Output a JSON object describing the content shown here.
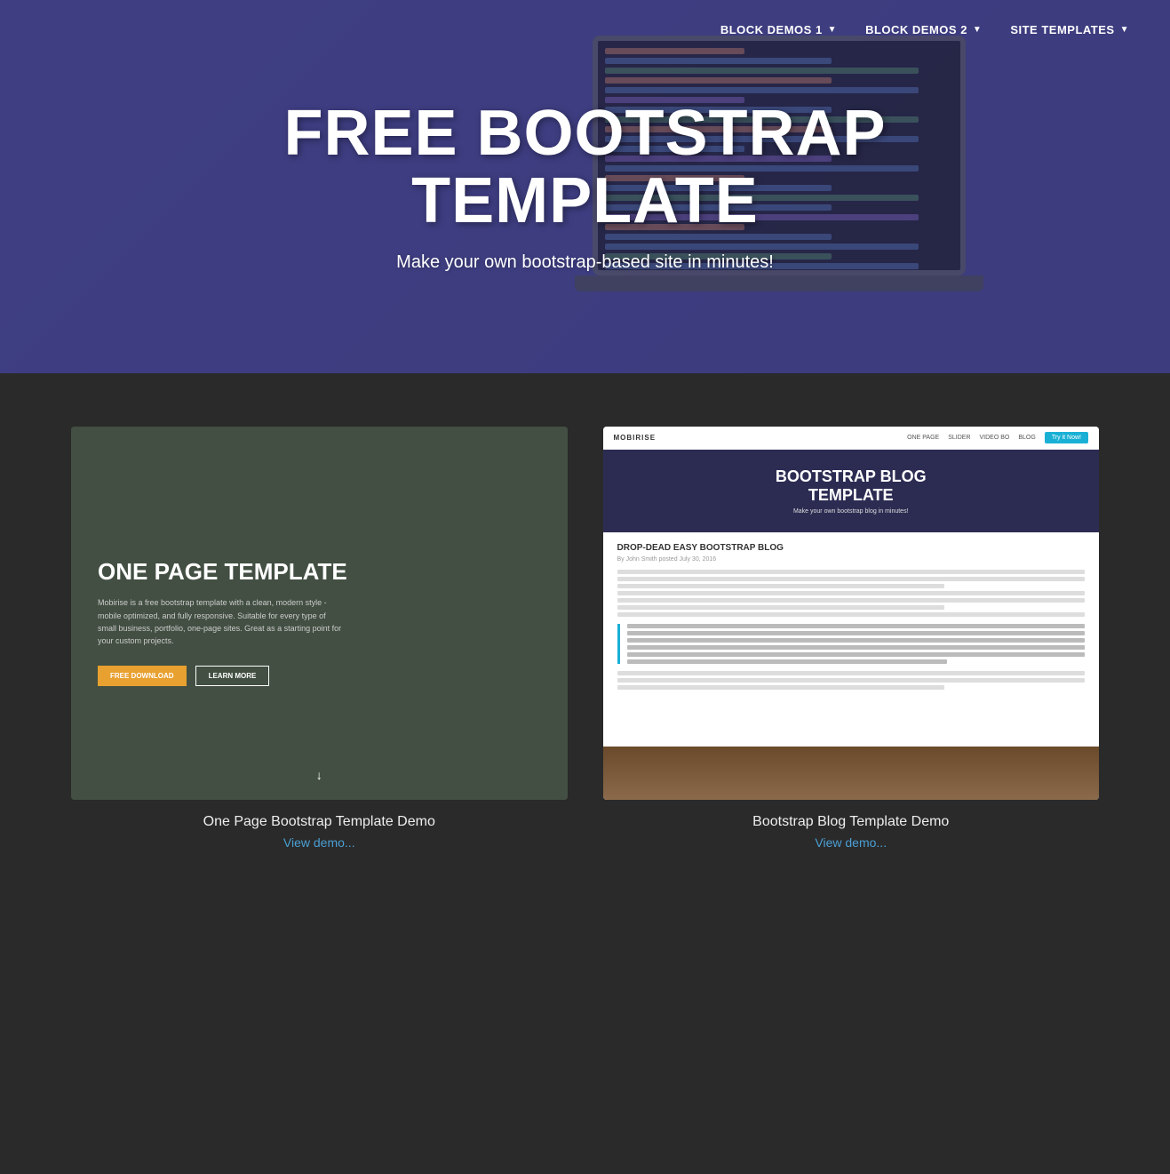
{
  "nav": {
    "items": [
      {
        "label": "BLOCK DEMOS 1",
        "has_dropdown": true
      },
      {
        "label": "BLOCK DEMOS 2",
        "has_dropdown": true
      },
      {
        "label": "SITE TEMPLATES",
        "has_dropdown": true
      }
    ]
  },
  "hero": {
    "title": "FREE BOOTSTRAP\nTEMPLATE",
    "subtitle": "Make your own bootstrap-based site in minutes!"
  },
  "templates": [
    {
      "id": "one-page",
      "name": "One Page Bootstrap Template Demo",
      "link_text": "View demo...",
      "preview": {
        "title": "ONE PAGE TEMPLATE",
        "description": "Mobirise is a free bootstrap template with a clean, modern style - mobile optimized, and fully responsive. Suitable for every type of small business, portfolio, one-page sites. Great as a starting point for your custom projects.",
        "btn1": "FREE DOWNLOAD",
        "btn2": "LEARN MORE"
      }
    },
    {
      "id": "blog",
      "name": "Bootstrap Blog Template Demo",
      "link_text": "View demo...",
      "preview": {
        "logo": "MOBIRISE",
        "nav_links": [
          "ONE PAGE",
          "SLIDER",
          "VIDEO BO",
          "BLOG"
        ],
        "nav_cta": "Try it Now!",
        "hero_title": "BOOTSTRAP BLOG\nTEMPLATE",
        "hero_subtitle": "Make your own bootstrap blog in minutes!",
        "article_title": "DROP-DEAD EASY BOOTSTRAP BLOG",
        "byline": "By John Smith posted July 30, 2016"
      }
    }
  ]
}
